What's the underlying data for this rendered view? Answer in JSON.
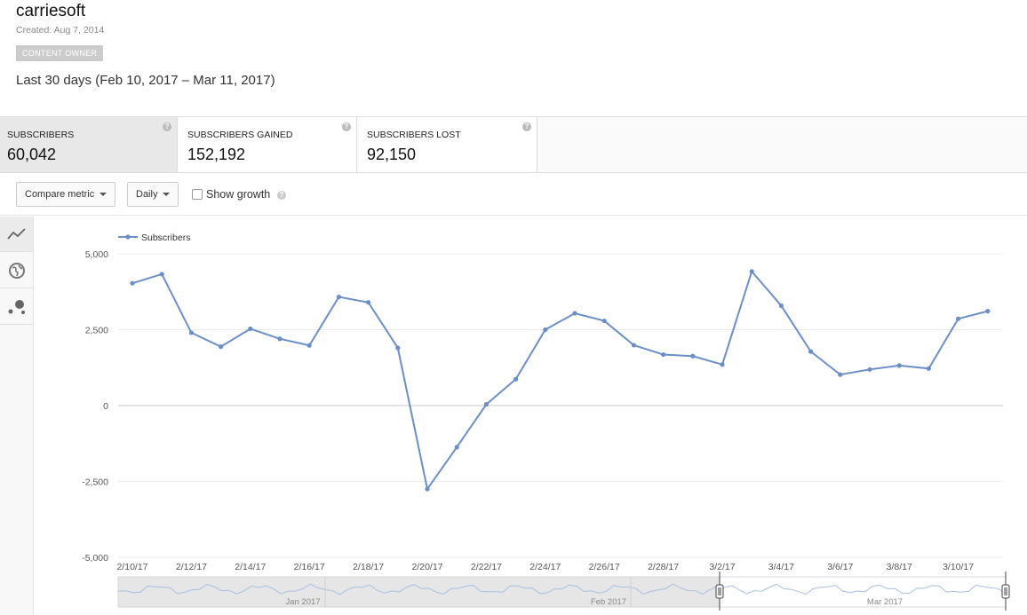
{
  "channel": {
    "name": "carriesoft",
    "created": "Created: Aug 7, 2014",
    "badge": "CONTENT OWNER"
  },
  "date_range": "Last 30 days (Feb 10, 2017 – Mar 11, 2017)",
  "metrics": [
    {
      "label": "SUBSCRIBERS",
      "value": "60,042",
      "active": true
    },
    {
      "label": "SUBSCRIBERS GAINED",
      "value": "152,192",
      "active": false
    },
    {
      "label": "SUBSCRIBERS LOST",
      "value": "92,150",
      "active": false
    }
  ],
  "toolbar": {
    "compare_label": "Compare metric",
    "interval_label": "Daily",
    "show_growth_label": "Show growth",
    "show_growth_checked": false
  },
  "side_tabs": [
    {
      "icon": "line-chart-icon",
      "active": true
    },
    {
      "icon": "globe-icon",
      "active": false
    },
    {
      "icon": "bubble-chart-icon",
      "active": false
    }
  ],
  "colors": {
    "series": "#6a8fc8",
    "range_shade": "#e6e6e6"
  },
  "chart_data": {
    "type": "line",
    "title": "",
    "xlabel": "",
    "ylabel": "",
    "ylim": [
      -5000,
      5000
    ],
    "yticks": [
      5000,
      2500,
      0,
      -2500,
      -5000
    ],
    "ytick_labels": [
      "5,000",
      "2,500",
      "0",
      "-2,500",
      "-5,000"
    ],
    "xtick_labels": [
      "2/10/17",
      "2/12/17",
      "2/14/17",
      "2/16/17",
      "2/18/17",
      "2/20/17",
      "2/22/17",
      "2/24/17",
      "2/26/17",
      "2/28/17",
      "3/2/17",
      "3/4/17",
      "3/6/17",
      "3/8/17",
      "3/10/17"
    ],
    "grid": true,
    "legend_position": "top-left",
    "x": [
      "2/10/17",
      "2/11/17",
      "2/12/17",
      "2/13/17",
      "2/14/17",
      "2/15/17",
      "2/16/17",
      "2/17/17",
      "2/18/17",
      "2/19/17",
      "2/20/17",
      "2/21/17",
      "2/22/17",
      "2/23/17",
      "2/24/17",
      "2/25/17",
      "2/26/17",
      "2/27/17",
      "2/28/17",
      "3/1/17",
      "3/2/17",
      "3/3/17",
      "3/4/17",
      "3/5/17",
      "3/6/17",
      "3/7/17",
      "3/8/17",
      "3/9/17",
      "3/10/17",
      "3/11/17"
    ],
    "series": [
      {
        "name": "Subscribers",
        "values": [
          4030,
          4330,
          2400,
          1940,
          2530,
          2200,
          1980,
          3580,
          3400,
          1900,
          -2750,
          -1370,
          40,
          870,
          2500,
          3040,
          2790,
          1990,
          1680,
          1630,
          1350,
          4420,
          3290,
          1780,
          1020,
          1190,
          1320,
          1220,
          2860,
          3110
        ]
      }
    ],
    "navigator": {
      "labels": [
        "Jan 2017",
        "Feb 2017",
        "Mar 2017"
      ]
    }
  }
}
